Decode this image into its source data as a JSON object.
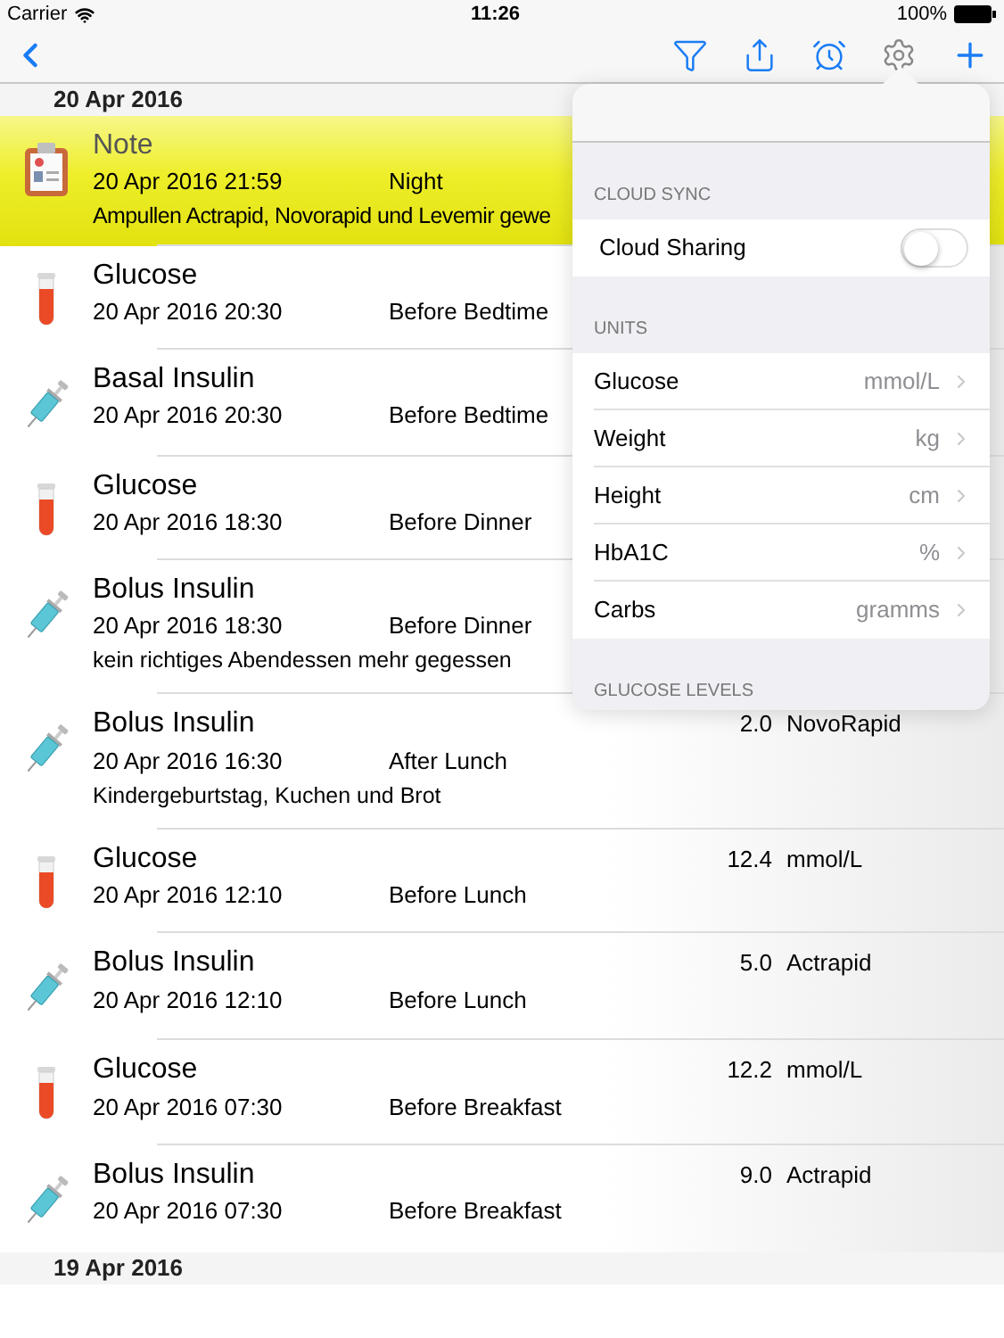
{
  "status_bar": {
    "carrier": "Carrier",
    "time": "11:26",
    "battery": "100%"
  },
  "sections": [
    {
      "header": "20 Apr 2016",
      "entries": [
        {
          "kind": "note",
          "highlighted": true,
          "title": "Note",
          "datetime": "20 Apr 2016 21:59",
          "period": "Night",
          "comment": "Ampullen Actrapid, Novorapid und Levemir gewe"
        },
        {
          "kind": "glucose",
          "highlighted": false,
          "title": "Glucose",
          "datetime": "20 Apr 2016 20:30",
          "period": "Before Bedtime"
        },
        {
          "kind": "insulin",
          "highlighted": false,
          "title": "Basal Insulin",
          "datetime": "20 Apr 2016 20:30",
          "period": "Before Bedtime"
        },
        {
          "kind": "glucose",
          "highlighted": false,
          "title": "Glucose",
          "datetime": "20 Apr 2016 18:30",
          "period": "Before Dinner"
        },
        {
          "kind": "insulin",
          "highlighted": false,
          "title": "Bolus Insulin",
          "datetime": "20 Apr 2016 18:30",
          "period": "Before Dinner",
          "comment": "kein richtiges Abendessen mehr gegessen"
        },
        {
          "kind": "insulin",
          "highlighted": false,
          "title": "Bolus Insulin",
          "datetime": "20 Apr 2016 16:30",
          "period": "After Lunch",
          "value": "2.0",
          "unit": "NovoRapid",
          "comment": "Kindergeburtstag, Kuchen und Brot"
        },
        {
          "kind": "glucose",
          "highlighted": false,
          "title": "Glucose",
          "datetime": "20 Apr 2016 12:10",
          "period": "Before Lunch",
          "value": "12.4",
          "unit": "mmol/L"
        },
        {
          "kind": "insulin",
          "highlighted": false,
          "title": "Bolus Insulin",
          "datetime": "20 Apr 2016 12:10",
          "period": "Before Lunch",
          "value": "5.0",
          "unit": "Actrapid"
        },
        {
          "kind": "glucose",
          "highlighted": false,
          "title": "Glucose",
          "datetime": "20 Apr 2016 07:30",
          "period": "Before Breakfast",
          "value": "12.2",
          "unit": "mmol/L"
        },
        {
          "kind": "insulin",
          "highlighted": false,
          "title": "Bolus Insulin",
          "datetime": "20 Apr 2016 07:30",
          "period": "Before Breakfast",
          "value": "9.0",
          "unit": "Actrapid"
        }
      ]
    },
    {
      "header": "19 Apr 2016"
    }
  ],
  "settings_popover": {
    "groups": [
      {
        "header": "CLOUD SYNC",
        "rows": [
          {
            "kind": "toggle",
            "label": "Cloud Sharing",
            "on": false
          }
        ]
      },
      {
        "header": "UNITS",
        "rows": [
          {
            "kind": "link",
            "label": "Glucose",
            "value": "mmol/L"
          },
          {
            "kind": "link",
            "label": "Weight",
            "value": "kg"
          },
          {
            "kind": "link",
            "label": "Height",
            "value": "cm"
          },
          {
            "kind": "link",
            "label": "HbA1C",
            "value": "%"
          },
          {
            "kind": "link",
            "label": "Carbs",
            "value": "gramms"
          }
        ]
      },
      {
        "header": "GLUCOSE LEVELS"
      }
    ]
  }
}
